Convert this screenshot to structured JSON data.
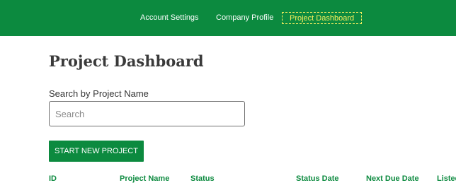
{
  "nav": {
    "items": [
      {
        "label": "Account Settings"
      },
      {
        "label": "Company Profile"
      },
      {
        "label": "Project Dashboard"
      }
    ],
    "active_color": "#f5ef5c",
    "brand_color": "#0c8a3f"
  },
  "main": {
    "title": "Project Dashboard",
    "search": {
      "label": "Search by Project Name",
      "placeholder": "Search",
      "value": ""
    },
    "start_button_label": "START NEW PROJECT",
    "table": {
      "columns": [
        "ID",
        "Project Name",
        "Status",
        "Status Date",
        "Next Due Date",
        "Listed"
      ]
    }
  }
}
